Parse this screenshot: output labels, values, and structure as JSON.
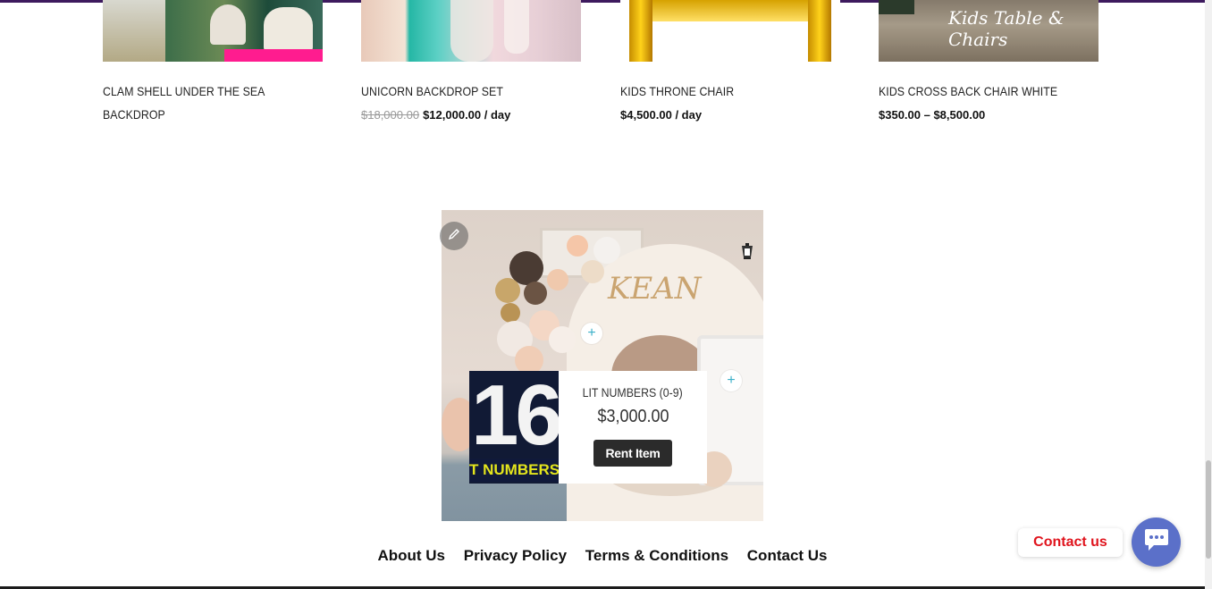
{
  "products": [
    {
      "title": "CLAM SHELL UNDER THE SEA BACKDROP",
      "old_price": "",
      "price": ""
    },
    {
      "title": "UNICORN BACKDROP SET",
      "old_price": "$18,000.00",
      "price": "$12,000.00 / day"
    },
    {
      "title": "KIDS THRONE CHAIR",
      "old_price": "",
      "price": "$4,500.00 / day"
    },
    {
      "title": "KIDS CROSS BACK CHAIR WHITE",
      "old_price": "",
      "price": "$350.00 – $8,500.00"
    }
  ],
  "product_image_text": {
    "kids_chair_script": "Kids Table & Chairs"
  },
  "feature": {
    "image_text": "KEAN",
    "hotspot_symbol": "+",
    "popup": {
      "thumb_number": "16",
      "thumb_caption": "T NUMBERS",
      "title": "LIT NUMBERS (0-9)",
      "price": "$3,000.00",
      "button": "Rent Item"
    }
  },
  "footer_nav": [
    "About Us",
    "Privacy Policy",
    "Terms & Conditions",
    "Contact Us"
  ],
  "contact_widget": {
    "label": "Contact us"
  },
  "colors": {
    "accent_purple": "#3d1a5e",
    "contact_red": "#e0141d",
    "chat_blue": "#5b70c9",
    "hotspot_teal": "#3cb0c9"
  },
  "icons": [
    "pencil-icon",
    "lamp-icon",
    "plus-icon",
    "chat-bubble-icon"
  ]
}
